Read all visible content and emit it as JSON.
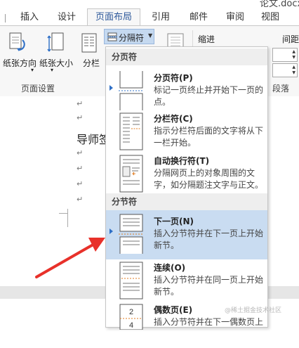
{
  "doc_title": "论文.docx",
  "tabs": [
    {
      "label": "插入"
    },
    {
      "label": "设计"
    },
    {
      "label": "页面布局"
    },
    {
      "label": "引用"
    },
    {
      "label": "邮件"
    },
    {
      "label": "审阅"
    },
    {
      "label": "视图"
    }
  ],
  "ribbon": {
    "orientation": "纸张方向",
    "size": "纸张大小",
    "columns": "分栏",
    "breaks": "分隔符",
    "page_setup_group": "页面设置",
    "indent_label": "缩进",
    "spacing_label": "间距",
    "paragraph_group": "段落"
  },
  "document": {
    "para_mark": "↵",
    "visible_text": "导师签"
  },
  "menu": {
    "section_page_breaks": "分页符",
    "section_section_breaks": "分节符",
    "items": [
      {
        "title": "分页符(P)",
        "desc": "标记一页终止并开始下一页的点。"
      },
      {
        "title": "分栏符(C)",
        "desc": "指示分栏符后面的文字将从下一栏开始。"
      },
      {
        "title": "自动换行符(T)",
        "desc": "分隔网页上的对象周围的文字，如分隔题注文字与正文。"
      },
      {
        "title": "下一页(N)",
        "desc": "插入分节符并在下一页上开始新节。"
      },
      {
        "title": "连续(O)",
        "desc": "插入分节符并在同一页上开始新节。"
      },
      {
        "title": "偶数页(E)",
        "desc": "插入分节符并在下一偶数页上"
      }
    ]
  },
  "watermark": "@稀土掘金技术社区",
  "colors": {
    "accent": "#2b579a",
    "highlight": "#c9dcf1",
    "arrow": "#e8312a"
  }
}
